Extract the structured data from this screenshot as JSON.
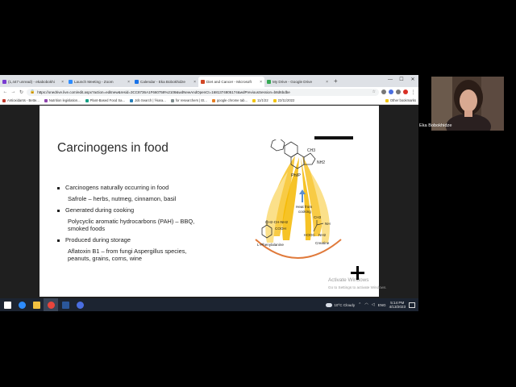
{
  "browser": {
    "tabs": [
      {
        "label": "(1,447 unread) - ekabobokhi",
        "color": "#7a3bd1",
        "active": false
      },
      {
        "label": "Launch Meeting - Zoom",
        "color": "#2d8cff",
        "active": false
      },
      {
        "label": "Calendar - Eka Bobokhidze",
        "color": "#1a73e8",
        "active": false
      },
      {
        "label": "Diet and Cancer - Microsoft",
        "color": "#d24726",
        "active": true
      },
      {
        "label": "My Drive - Google Drive",
        "color": "#34a853",
        "active": false
      }
    ],
    "new_tab": "+",
    "window_controls": [
      "—",
      "☐",
      "✕"
    ],
    "url": "https://onedrive.live.com/edit.aspx?action=editnew&resid=3CC8736A1F660758%2108&wdNewAndOpenCt=1681374805174&wdPreviousSession=b8d6bdbe",
    "bookmarks": [
      {
        "label": "Antioxidants - Bette...",
        "color": "#c0392b"
      },
      {
        "label": "Nutrition legislation...",
        "color": "#8e44ad"
      },
      {
        "label": "Plant-Based Food Sa...",
        "color": "#16a085"
      },
      {
        "label": "Job Search | f-kara...",
        "color": "#2980b9"
      },
      {
        "label": "for researchers | Et...",
        "color": "#7f8c8d"
      },
      {
        "label": "google chrome tab...",
        "color": "#e67e22"
      },
      {
        "label": "11/1/22",
        "color": "#f1c40f"
      },
      {
        "label": "22/11/2022",
        "color": "#f1c40f"
      }
    ],
    "other_bookmarks": "Other bookmarks"
  },
  "slide": {
    "title": "Carcinogens in food",
    "bullets": [
      {
        "kind": "bullet",
        "text": "Carcinogens naturally occurring in food"
      },
      {
        "kind": "sub",
        "text": "Safrole – herbs, nutmeg, cinnamon, basil"
      },
      {
        "kind": "bullet",
        "text": "Generated during cooking"
      },
      {
        "kind": "sub",
        "text": "Polycyclic aromatic hydrocarbons (PAH) – BBQ,"
      },
      {
        "kind": "sub-cont",
        "text": "smoked foods"
      },
      {
        "kind": "bullet",
        "text": "Produced during storage"
      },
      {
        "kind": "sub",
        "text": "Aflatoxin B1 – from fungi Aspergillus species,"
      },
      {
        "kind": "sub-cont",
        "text": "peanuts, grains, corns, wine"
      }
    ],
    "diagram": {
      "top_molecule_label": "PhIP",
      "top_group_ch3": "CH3",
      "top_group_nh2": "NH2",
      "heat_label_line1": "Heat from",
      "heat_label_line2": "cooking",
      "left_molecule_top": "CH2-CH-NH2",
      "left_molecule_cooh": "COOH",
      "left_molecule_label": "L-Phenylalanine",
      "right_molecule_ch3": "CH3",
      "right_molecule_nh": "NH",
      "right_molecule_hooc": "HOOC",
      "right_molecule_nh2": "NH2",
      "right_molecule_label": "Creatine"
    },
    "activate_line1": "Activate Windows",
    "activate_line2": "Go to Settings to activate Windows."
  },
  "taskbar": {
    "apps": [
      {
        "name": "start",
        "color": "#ffffff"
      },
      {
        "name": "zoom",
        "color": "#2d8cff"
      },
      {
        "name": "file-explorer",
        "color": "#f0c040"
      },
      {
        "name": "chrome",
        "color": "#e8453c"
      },
      {
        "name": "word",
        "color": "#2b579a"
      },
      {
        "name": "teams",
        "color": "#4a6ee0"
      }
    ],
    "weather": "10°C  Cloudy",
    "lang": "ENG",
    "time": "5:14 PM",
    "date": "4/13/2023"
  },
  "participant": {
    "name": "Eka Bobokhidze"
  }
}
